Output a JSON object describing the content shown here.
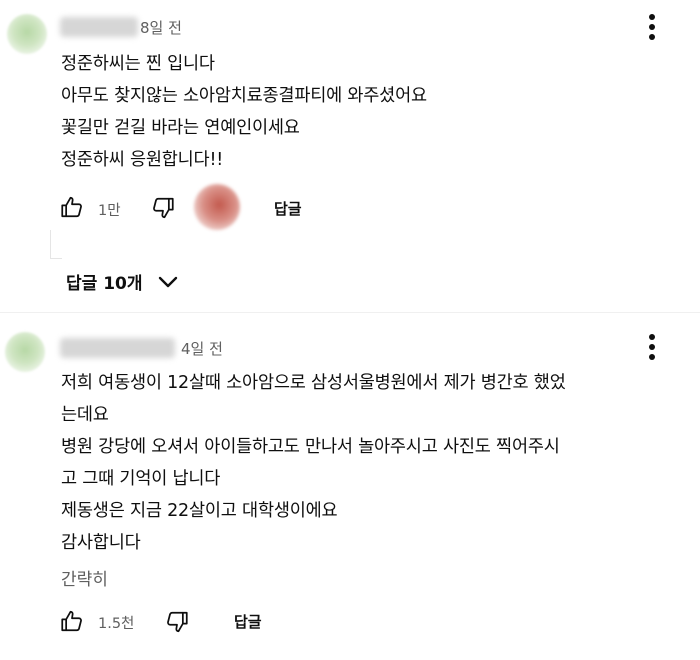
{
  "comments": [
    {
      "time": "8일 전",
      "lines": [
        "정준하씨는 찐 입니다",
        "아무도 찾지않는 소아암치료종결파티에 와주셨어요",
        "꽃길만 걷길 바라는 연예인이세요",
        "정준하씨 응원합니다!!"
      ],
      "likes": "1만",
      "reply_label": "답글",
      "replies_toggle": "답글 10개"
    },
    {
      "time": "4일 전",
      "lines": [
        "저희 여동생이 12살때 소아암으로 삼성서울병원에서 제가 병간호 했었",
        "는데요",
        "병원 강당에 오셔서 아이들하고도 만나서 놀아주시고 사진도 찍어주시",
        "고 그때 기억이 납니다",
        "제동생은 지금 22살이고 대학생이에요",
        "감사합니다"
      ],
      "read_less": "간략히",
      "likes": "1.5천",
      "reply_label": "답글"
    }
  ],
  "icons": {
    "like": "thumbs-up-icon",
    "dislike": "thumbs-down-icon",
    "more": "more-vert-icon",
    "expand": "chevron-down-icon"
  },
  "colors": {
    "text": "#0f0f0f",
    "secondary": "#606060",
    "creator_heart_avatar": "#c35a4e"
  }
}
